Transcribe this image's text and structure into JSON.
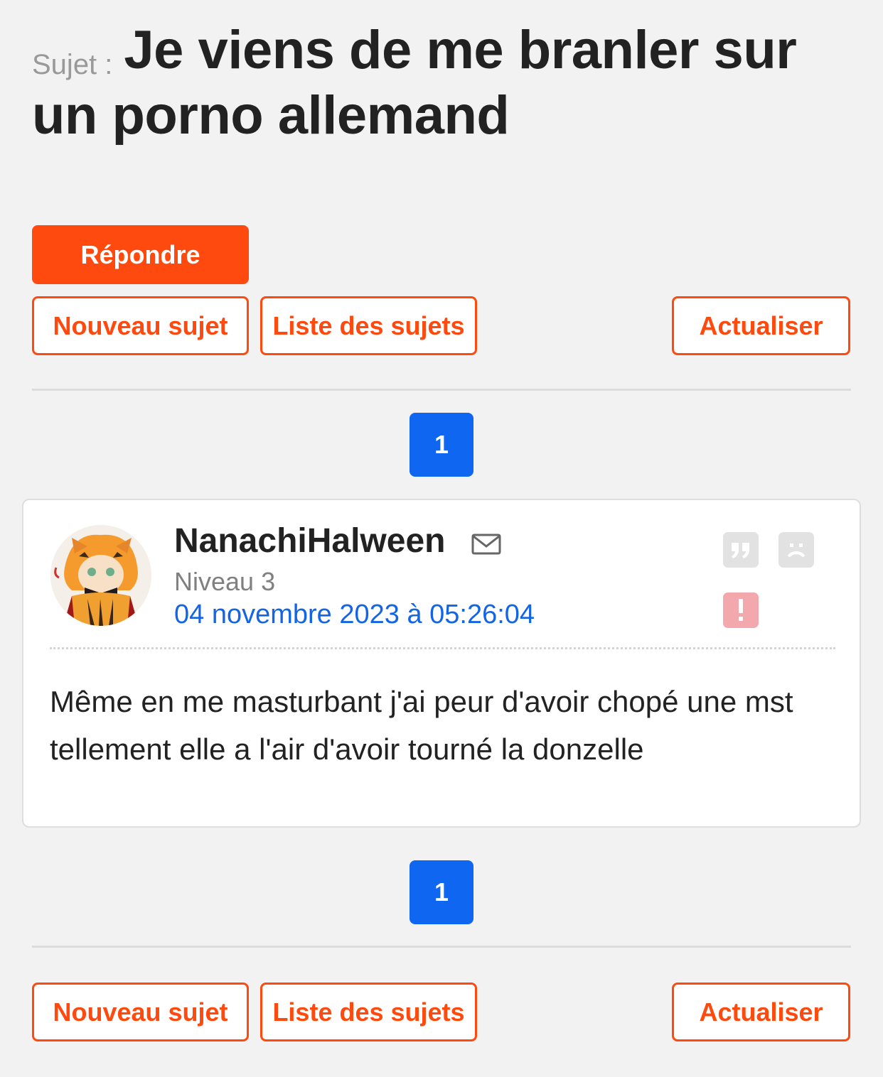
{
  "topic": {
    "label": "Sujet :",
    "title": "Je viens de me branler sur un porno allemand"
  },
  "actions": {
    "reply": "Répondre",
    "new_topic": "Nouveau sujet",
    "topic_list": "Liste des sujets",
    "refresh": "Actualiser"
  },
  "pagination": {
    "current": "1"
  },
  "post": {
    "author": "NanachiHalween",
    "level": "Niveau 3",
    "date": "04 novembre 2023 à 05:26:04",
    "body": "Même en me masturbant j'ai peur d'avoir chopé une mst tellement elle a l'air d'avoir tourné la donzelle",
    "icons": [
      "mail-icon",
      "quote-icon",
      "sad-face-icon",
      "report-icon"
    ]
  },
  "colors": {
    "accent": "#ff4a0f",
    "page_button": "#0f66f0",
    "date_link": "#1464e6",
    "report": "#f2a8ac"
  }
}
